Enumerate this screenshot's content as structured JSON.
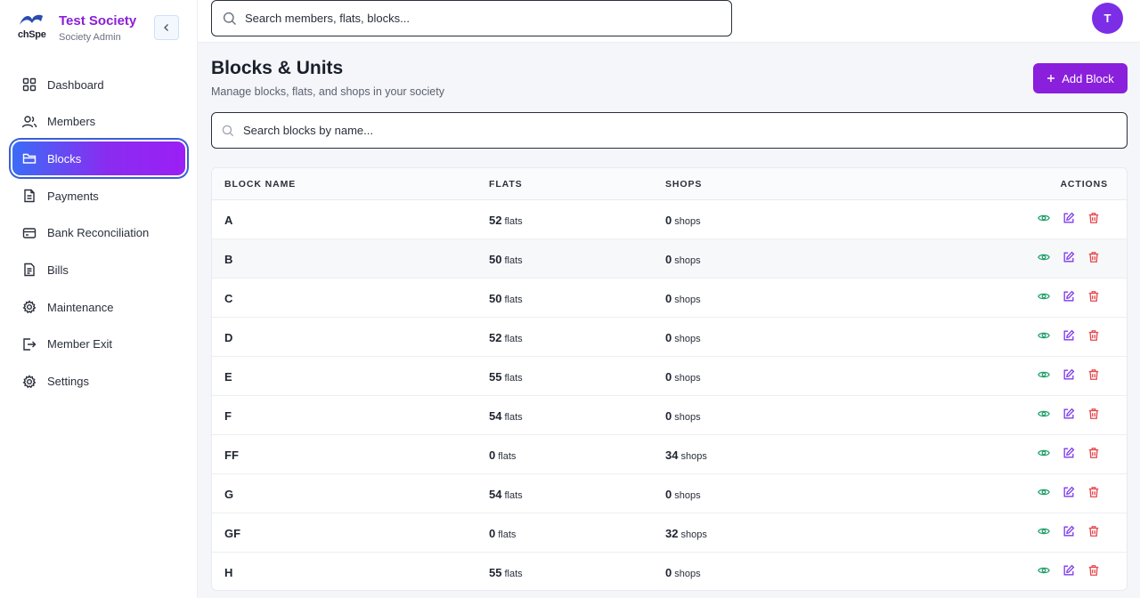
{
  "brand": {
    "name": "Test Society",
    "role": "Society Admin",
    "logo_text": "chSpe"
  },
  "search": {
    "placeholder": "Search members, flats, blocks..."
  },
  "user": {
    "initial": "T"
  },
  "sidebar": {
    "items": [
      {
        "label": "Dashboard",
        "icon": "dashboard-grid-icon"
      },
      {
        "label": "Members",
        "icon": "members-icon"
      },
      {
        "label": "Blocks",
        "icon": "folder-icon",
        "active": true
      },
      {
        "label": "Payments",
        "icon": "document-icon"
      },
      {
        "label": "Bank Reconciliation",
        "icon": "credit-card-icon"
      },
      {
        "label": "Bills",
        "icon": "bill-icon"
      },
      {
        "label": "Maintenance",
        "icon": "maintenance-gear-icon"
      },
      {
        "label": "Member Exit",
        "icon": "exit-icon"
      },
      {
        "label": "Settings",
        "icon": "settings-gear-icon"
      }
    ]
  },
  "page": {
    "title": "Blocks & Units",
    "subtitle": "Manage blocks, flats, and shops in your society",
    "add_label": "Add Block",
    "search_placeholder": "Search blocks by name..."
  },
  "table": {
    "headers": {
      "name": "BLOCK NAME",
      "flats": "FLATS",
      "shops": "SHOPS",
      "actions": "ACTIONS"
    },
    "flats_unit": "flats",
    "shops_unit": "shops",
    "rows": [
      {
        "name": "A",
        "flats": "52",
        "shops": "0"
      },
      {
        "name": "B",
        "flats": "50",
        "shops": "0"
      },
      {
        "name": "C",
        "flats": "50",
        "shops": "0"
      },
      {
        "name": "D",
        "flats": "52",
        "shops": "0"
      },
      {
        "name": "E",
        "flats": "55",
        "shops": "0"
      },
      {
        "name": "F",
        "flats": "54",
        "shops": "0"
      },
      {
        "name": "FF",
        "flats": "0",
        "shops": "34"
      },
      {
        "name": "G",
        "flats": "54",
        "shops": "0"
      },
      {
        "name": "GF",
        "flats": "0",
        "shops": "32"
      },
      {
        "name": "H",
        "flats": "55",
        "shops": "0"
      }
    ]
  },
  "colors": {
    "accent": "#8a1fdc",
    "view": "#22a06b",
    "edit": "#7c3aed",
    "delete": "#e5484d"
  }
}
